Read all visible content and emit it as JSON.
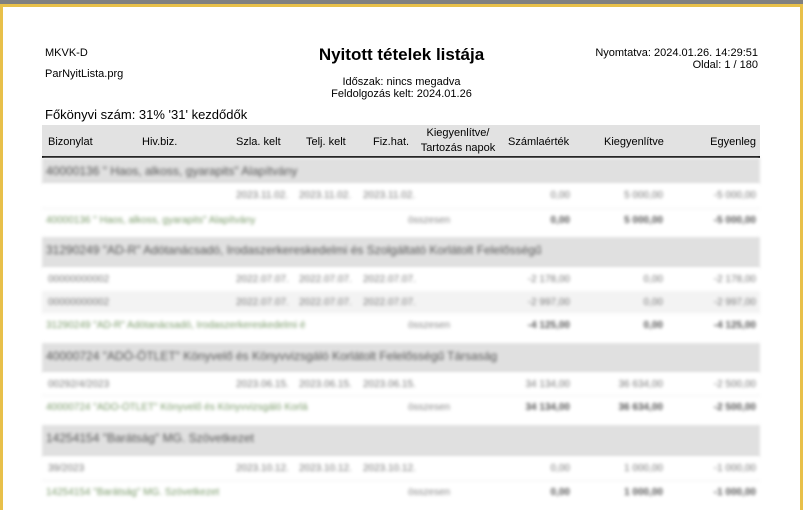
{
  "header": {
    "company": "MKVK-D",
    "program": "ParNyitLista.prg",
    "title": "Nyitott tételek listája",
    "printed": "Nyomtatva: 2024.01.26. 14:29:51",
    "page": "Oldal: 1 / 180",
    "period": "Időszak: nincs megadva",
    "processed": "Feldolgozás kelt: 2024.01.26",
    "ledger": "Főkönyvi szám:  31% '31' kezdődők"
  },
  "columns": [
    "Bizonylat",
    "Hiv.biz.",
    "Szla. kelt",
    "Telj. kelt",
    "Fiz.hat.",
    "Kiegyenlítve/",
    "Tartozás napok",
    "Számlaérték",
    "Kiegyenlítve",
    "Egyenleg"
  ],
  "groups": [
    {
      "name": "40000136 \" Haos, alkoss, gyarapits\" Alapítvány",
      "details": [
        {
          "doc": "",
          "szla": "2023.11.02.",
          "telj": "2023.11.02.",
          "fiz": "2023.11.02.",
          "value": "0,00",
          "paid": "5 000,00",
          "balance": "-5 000,00"
        }
      ],
      "total": {
        "label": "40000136 \" Haos, alkoss, gyarapits\" Alapítvány",
        "status": "összesen",
        "value": "0,00",
        "paid": "5 000,00",
        "balance": "-5 000,00"
      }
    },
    {
      "name": "31290249 \"AD-R\" Adótanácsadó, Irodaszerkereskedelmi és Szolgáltató Korlátolt Felelősségű",
      "details": [
        {
          "doc": "00000000002",
          "szla": "2022.07.07.",
          "telj": "2022.07.07.",
          "fiz": "2022.07.07.",
          "value": "-2 178,00",
          "paid": "0,00",
          "balance": "-2 178,00"
        },
        {
          "doc": "00000000002",
          "szla": "2022.07.07.",
          "telj": "2022.07.07.",
          "fiz": "2022.07.07.",
          "value": "-2 997,00",
          "paid": "0,00",
          "balance": "-2 997,00"
        }
      ],
      "total": {
        "label": "31290249 \"AD-R\" Adótanácsadó, Irodaszerkereskedelmi é",
        "status": "összesen",
        "value": "-4 125,00",
        "paid": "0,00",
        "balance": "-4 125,00"
      }
    },
    {
      "name": "40000724 \"ADÓ-ÖTLET\" Könyvelő és Könyvvizsgáló Korlátolt Felelősségű Társaság",
      "details": [
        {
          "doc": "00292/4/2023",
          "szla": "2023.06.15.",
          "telj": "2023.06.15.",
          "fiz": "2023.06.15.",
          "value": "34 134,00",
          "paid": "36 634,00",
          "balance": "-2 500,00"
        }
      ],
      "total": {
        "label": "40000724 \"ADÓ-ÖTLET\" Könyvelő és Könyvvizsgáló Korlá",
        "status": "összesen",
        "value": "34 134,00",
        "paid": "36 634,00",
        "balance": "-2 500,00"
      }
    },
    {
      "name": "14254154 \"Barátság\" MG. Szövetkezet",
      "details": [
        {
          "doc": "39/2023",
          "szla": "2023.10.12.",
          "telj": "2023.10.12.",
          "fiz": "2023.10.12.",
          "value": "0,00",
          "paid": "1 000,00",
          "balance": "-1 000,00"
        }
      ],
      "total": {
        "label": "14254154 \"Barátság\" MG. Szövetkezet",
        "status": "összesen",
        "value": "0,00",
        "paid": "1 000,00",
        "balance": "-1 000,00"
      }
    }
  ]
}
